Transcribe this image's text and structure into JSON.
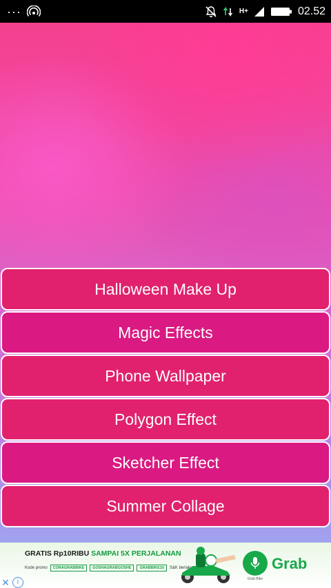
{
  "status_bar": {
    "dots": "···",
    "left_icon": "hotspot-icon",
    "mute_icon": "bell-off-icon",
    "data_icon": "data-transfer-icon",
    "network_label": "H+",
    "signal_icon": "signal-icon",
    "battery_icon": "battery-icon",
    "time": "02.52"
  },
  "menu": {
    "items": [
      {
        "label": "Halloween Make Up"
      },
      {
        "label": "Magic Effects"
      },
      {
        "label": "Phone Wallpaper"
      },
      {
        "label": "Polygon Effect"
      },
      {
        "label": "Sketcher Effect"
      },
      {
        "label": "Summer Collage"
      }
    ]
  },
  "ad": {
    "headline_part1": "GRATIS Rp10RIBU ",
    "headline_part2": "SAMPAI 5X PERJALANAN",
    "promo_label": "Kode promo",
    "code1": "CORAGRABBIKE",
    "code2": "GOSHAGRABGOSHE",
    "code3": "GRABBIKE10",
    "code4": "S&K berlaku",
    "mic_label": "Grab Bike",
    "brand": "Grab",
    "close_icon": "close-icon",
    "info_icon": "info-icon"
  },
  "colors": {
    "button_primary": "#e2216e",
    "button_secondary": "#da1a82",
    "brand_green": "#17a84a"
  }
}
